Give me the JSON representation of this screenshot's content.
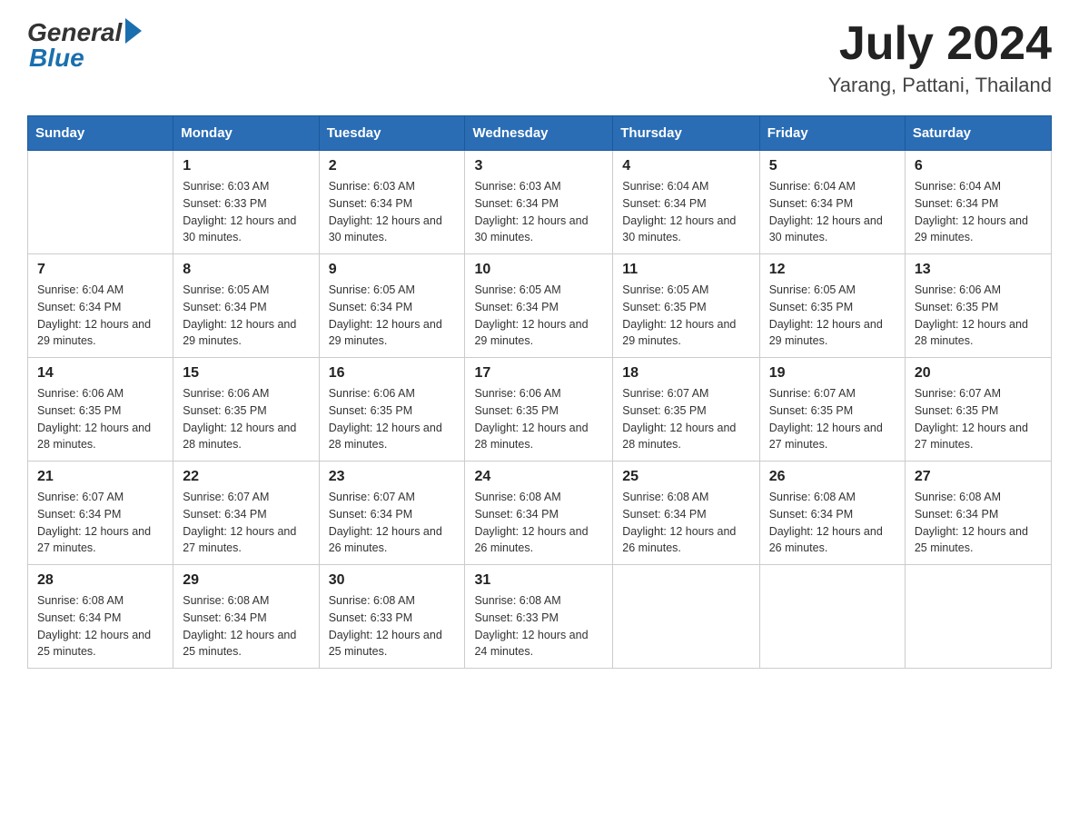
{
  "logo": {
    "general": "General",
    "blue": "Blue"
  },
  "title": {
    "month_year": "July 2024",
    "location": "Yarang, Pattani, Thailand"
  },
  "headers": [
    "Sunday",
    "Monday",
    "Tuesday",
    "Wednesday",
    "Thursday",
    "Friday",
    "Saturday"
  ],
  "weeks": [
    [
      {
        "day": "",
        "sunrise": "",
        "sunset": "",
        "daylight": ""
      },
      {
        "day": "1",
        "sunrise": "Sunrise: 6:03 AM",
        "sunset": "Sunset: 6:33 PM",
        "daylight": "Daylight: 12 hours and 30 minutes."
      },
      {
        "day": "2",
        "sunrise": "Sunrise: 6:03 AM",
        "sunset": "Sunset: 6:34 PM",
        "daylight": "Daylight: 12 hours and 30 minutes."
      },
      {
        "day": "3",
        "sunrise": "Sunrise: 6:03 AM",
        "sunset": "Sunset: 6:34 PM",
        "daylight": "Daylight: 12 hours and 30 minutes."
      },
      {
        "day": "4",
        "sunrise": "Sunrise: 6:04 AM",
        "sunset": "Sunset: 6:34 PM",
        "daylight": "Daylight: 12 hours and 30 minutes."
      },
      {
        "day": "5",
        "sunrise": "Sunrise: 6:04 AM",
        "sunset": "Sunset: 6:34 PM",
        "daylight": "Daylight: 12 hours and 30 minutes."
      },
      {
        "day": "6",
        "sunrise": "Sunrise: 6:04 AM",
        "sunset": "Sunset: 6:34 PM",
        "daylight": "Daylight: 12 hours and 29 minutes."
      }
    ],
    [
      {
        "day": "7",
        "sunrise": "Sunrise: 6:04 AM",
        "sunset": "Sunset: 6:34 PM",
        "daylight": "Daylight: 12 hours and 29 minutes."
      },
      {
        "day": "8",
        "sunrise": "Sunrise: 6:05 AM",
        "sunset": "Sunset: 6:34 PM",
        "daylight": "Daylight: 12 hours and 29 minutes."
      },
      {
        "day": "9",
        "sunrise": "Sunrise: 6:05 AM",
        "sunset": "Sunset: 6:34 PM",
        "daylight": "Daylight: 12 hours and 29 minutes."
      },
      {
        "day": "10",
        "sunrise": "Sunrise: 6:05 AM",
        "sunset": "Sunset: 6:34 PM",
        "daylight": "Daylight: 12 hours and 29 minutes."
      },
      {
        "day": "11",
        "sunrise": "Sunrise: 6:05 AM",
        "sunset": "Sunset: 6:35 PM",
        "daylight": "Daylight: 12 hours and 29 minutes."
      },
      {
        "day": "12",
        "sunrise": "Sunrise: 6:05 AM",
        "sunset": "Sunset: 6:35 PM",
        "daylight": "Daylight: 12 hours and 29 minutes."
      },
      {
        "day": "13",
        "sunrise": "Sunrise: 6:06 AM",
        "sunset": "Sunset: 6:35 PM",
        "daylight": "Daylight: 12 hours and 28 minutes."
      }
    ],
    [
      {
        "day": "14",
        "sunrise": "Sunrise: 6:06 AM",
        "sunset": "Sunset: 6:35 PM",
        "daylight": "Daylight: 12 hours and 28 minutes."
      },
      {
        "day": "15",
        "sunrise": "Sunrise: 6:06 AM",
        "sunset": "Sunset: 6:35 PM",
        "daylight": "Daylight: 12 hours and 28 minutes."
      },
      {
        "day": "16",
        "sunrise": "Sunrise: 6:06 AM",
        "sunset": "Sunset: 6:35 PM",
        "daylight": "Daylight: 12 hours and 28 minutes."
      },
      {
        "day": "17",
        "sunrise": "Sunrise: 6:06 AM",
        "sunset": "Sunset: 6:35 PM",
        "daylight": "Daylight: 12 hours and 28 minutes."
      },
      {
        "day": "18",
        "sunrise": "Sunrise: 6:07 AM",
        "sunset": "Sunset: 6:35 PM",
        "daylight": "Daylight: 12 hours and 28 minutes."
      },
      {
        "day": "19",
        "sunrise": "Sunrise: 6:07 AM",
        "sunset": "Sunset: 6:35 PM",
        "daylight": "Daylight: 12 hours and 27 minutes."
      },
      {
        "day": "20",
        "sunrise": "Sunrise: 6:07 AM",
        "sunset": "Sunset: 6:35 PM",
        "daylight": "Daylight: 12 hours and 27 minutes."
      }
    ],
    [
      {
        "day": "21",
        "sunrise": "Sunrise: 6:07 AM",
        "sunset": "Sunset: 6:34 PM",
        "daylight": "Daylight: 12 hours and 27 minutes."
      },
      {
        "day": "22",
        "sunrise": "Sunrise: 6:07 AM",
        "sunset": "Sunset: 6:34 PM",
        "daylight": "Daylight: 12 hours and 27 minutes."
      },
      {
        "day": "23",
        "sunrise": "Sunrise: 6:07 AM",
        "sunset": "Sunset: 6:34 PM",
        "daylight": "Daylight: 12 hours and 26 minutes."
      },
      {
        "day": "24",
        "sunrise": "Sunrise: 6:08 AM",
        "sunset": "Sunset: 6:34 PM",
        "daylight": "Daylight: 12 hours and 26 minutes."
      },
      {
        "day": "25",
        "sunrise": "Sunrise: 6:08 AM",
        "sunset": "Sunset: 6:34 PM",
        "daylight": "Daylight: 12 hours and 26 minutes."
      },
      {
        "day": "26",
        "sunrise": "Sunrise: 6:08 AM",
        "sunset": "Sunset: 6:34 PM",
        "daylight": "Daylight: 12 hours and 26 minutes."
      },
      {
        "day": "27",
        "sunrise": "Sunrise: 6:08 AM",
        "sunset": "Sunset: 6:34 PM",
        "daylight": "Daylight: 12 hours and 25 minutes."
      }
    ],
    [
      {
        "day": "28",
        "sunrise": "Sunrise: 6:08 AM",
        "sunset": "Sunset: 6:34 PM",
        "daylight": "Daylight: 12 hours and 25 minutes."
      },
      {
        "day": "29",
        "sunrise": "Sunrise: 6:08 AM",
        "sunset": "Sunset: 6:34 PM",
        "daylight": "Daylight: 12 hours and 25 minutes."
      },
      {
        "day": "30",
        "sunrise": "Sunrise: 6:08 AM",
        "sunset": "Sunset: 6:33 PM",
        "daylight": "Daylight: 12 hours and 25 minutes."
      },
      {
        "day": "31",
        "sunrise": "Sunrise: 6:08 AM",
        "sunset": "Sunset: 6:33 PM",
        "daylight": "Daylight: 12 hours and 24 minutes."
      },
      {
        "day": "",
        "sunrise": "",
        "sunset": "",
        "daylight": ""
      },
      {
        "day": "",
        "sunrise": "",
        "sunset": "",
        "daylight": ""
      },
      {
        "day": "",
        "sunrise": "",
        "sunset": "",
        "daylight": ""
      }
    ]
  ]
}
